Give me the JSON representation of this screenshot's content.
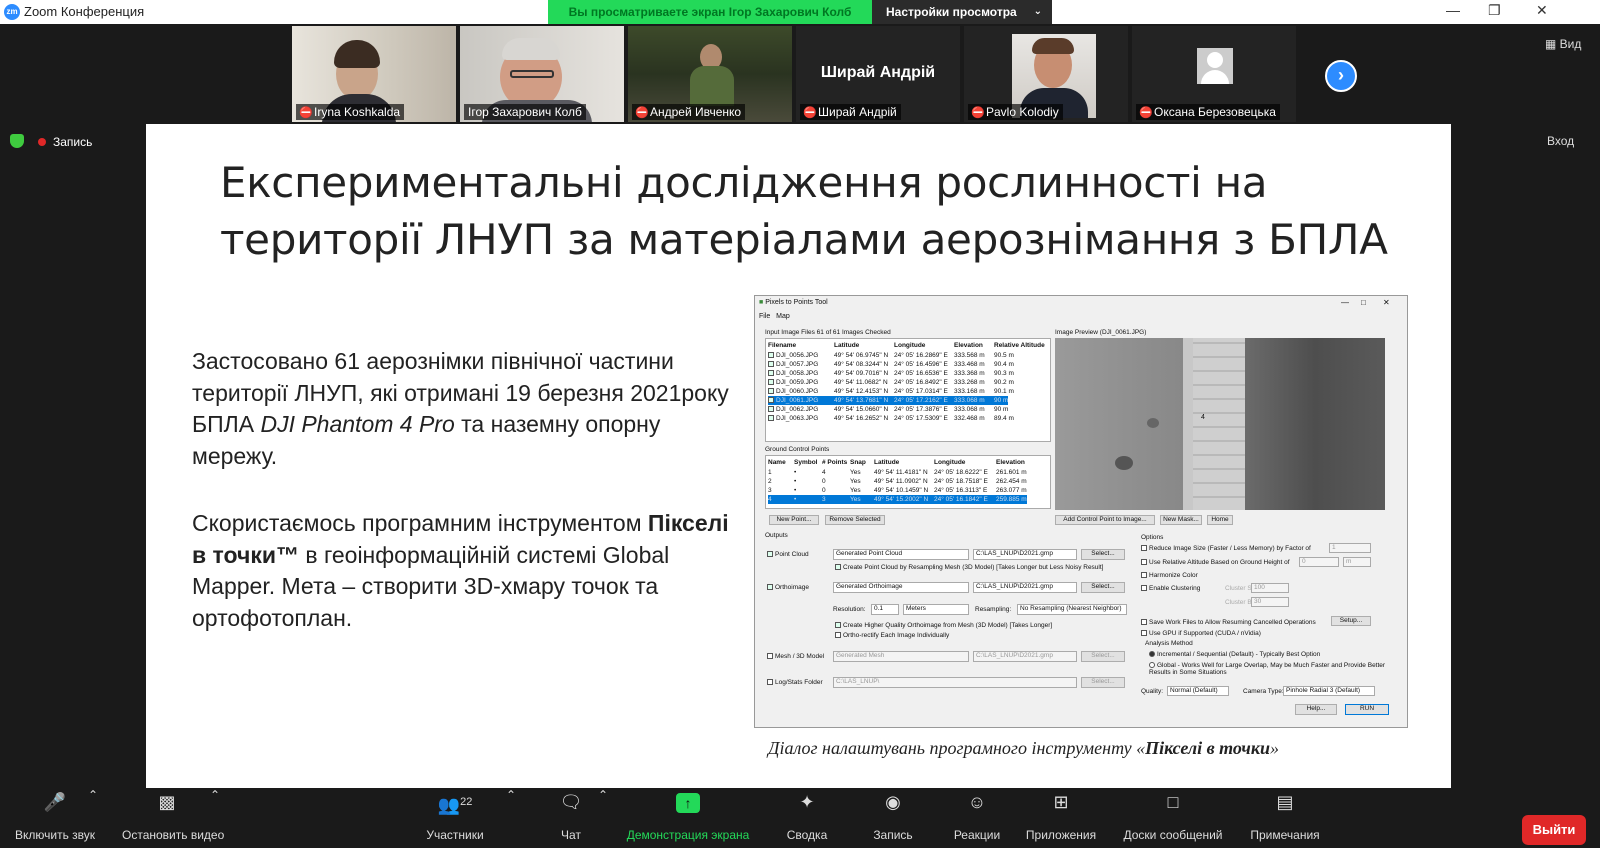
{
  "app": {
    "title": "Zoom Конференция",
    "logo": "zm"
  },
  "share_banner": {
    "text": "Вы просматриваете экран Ігор Захарович Колб",
    "settings": "Настройки просмотра"
  },
  "view_button": "Вид",
  "next_icon": "chevron-right-icon",
  "participants": [
    {
      "name": "Iryna Koshkalda",
      "video": true,
      "muted": true
    },
    {
      "name": "Ігор Захарович Колб",
      "video": true,
      "muted": false,
      "active": true
    },
    {
      "name": "Андрей Ивченко",
      "video": true,
      "muted": true
    },
    {
      "name": "Ширай Андрій",
      "video": false,
      "muted": true,
      "display": "Ширай Андрій"
    },
    {
      "name": "Pavlo Kolodiy",
      "video": true,
      "muted": true
    },
    {
      "name": "Оксана Березовецька",
      "video": false,
      "muted": true
    }
  ],
  "recording": {
    "label": "Запись"
  },
  "enter_button": "Вход",
  "slide": {
    "title": "Експериментальні дослідження рослинності на території  ЛНУП за матеріалами аерознімання з БПЛА",
    "para1": {
      "a": "Застосовано 61 аерознімки північної частини території ЛНУП, які отримані 19 березня 2021року БПЛА ",
      "em": "DJI Phantom 4 Pro",
      "b": " та наземну опорну мережу."
    },
    "para2": {
      "a": "Скористаємось програмним інструментом ",
      "strong": "Пікселі в точки™",
      "b": " в геоінформаційній системі Global Mapper.  Мета – створити 3D-хмару точок та ортофотоплан."
    },
    "caption": {
      "a": "Діалог налаштувань програмного інструменту «",
      "strong": "Пікселі в точки",
      "b": "»"
    }
  },
  "dialog": {
    "title": "Pixels to Points Tool",
    "menu": [
      "File",
      "Map"
    ],
    "input_header": "Input Image Files 61 of 61 Images Checked",
    "image_columns": [
      "Filename",
      "Latitude",
      "Longitude",
      "Elevation",
      "Relative Altitude"
    ],
    "images": [
      [
        "DJI_0056.JPG",
        "49° 54' 06.9745\" N",
        "24° 05' 16.2869\" E",
        "333.568 m",
        "90.5 m"
      ],
      [
        "DJI_0057.JPG",
        "49° 54' 08.3244\" N",
        "24° 05' 16.4596\" E",
        "333.468 m",
        "90.4 m"
      ],
      [
        "DJI_0058.JPG",
        "49° 54' 09.7016\" N",
        "24° 05' 16.6536\" E",
        "333.368 m",
        "90.3 m"
      ],
      [
        "DJI_0059.JPG",
        "49° 54' 11.0682\" N",
        "24° 05' 16.8492\" E",
        "333.268 m",
        "90.2 m"
      ],
      [
        "DJI_0060.JPG",
        "49° 54' 12.4153\" N",
        "24° 05' 17.0314\" E",
        "333.168 m",
        "90.1 m"
      ],
      [
        "DJI_0061.JPG",
        "49° 54' 13.7681\" N",
        "24° 05' 17.2162\" E",
        "333.068 m",
        "90 m"
      ],
      [
        "DJI_0062.JPG",
        "49° 54' 15.0660\" N",
        "24° 05' 17.3876\" E",
        "333.068 m",
        "90 m"
      ],
      [
        "DJI_0063.JPG",
        "49° 54' 16.2652\" N",
        "24° 05' 17.5309\" E",
        "332.468 m",
        "89.4 m"
      ]
    ],
    "preview_header": "Image Preview (DJI_0061.JPG)",
    "preview_marker": "4",
    "gcp_header": "Ground Control Points",
    "gcp_columns": [
      "Name",
      "Symbol",
      "# Points",
      "Snap",
      "Latitude",
      "Longitude",
      "Elevation"
    ],
    "gcps": [
      [
        "1",
        "•",
        "4",
        "Yes",
        "49° 54' 11.4181\" N",
        "24° 05' 18.6222\" E",
        "261.601 m"
      ],
      [
        "2",
        "•",
        "0",
        "Yes",
        "49° 54' 11.0902\" N",
        "24° 05' 18.7518\" E",
        "262.454 m"
      ],
      [
        "3",
        "•",
        "0",
        "Yes",
        "49° 54' 10.1459\" N",
        "24° 05' 16.3113\" E",
        "263.077 m"
      ],
      [
        "4",
        "•",
        "3",
        "Yes",
        "49° 54' 15.2002\" N",
        "24° 05' 16.1842\" E",
        "259.885 m"
      ]
    ],
    "btn_new_point": "New Point...",
    "btn_remove": "Remove Selected",
    "btn_add_cp": "Add Control Point to Image...",
    "btn_new_mask": "New Mask...",
    "btn_home": "Home",
    "outputs_label": "Outputs",
    "point_cloud": {
      "label": "Point Cloud",
      "name": "Generated Point Cloud",
      "path": "C:\\LAS_LNUP\\D2021.gmp",
      "select": "Select...",
      "resample": "Create Point Cloud by Resampling Mesh (3D Model) [Takes Longer but Less Noisy Result]"
    },
    "orthoimage": {
      "label": "Orthoimage",
      "name": "Generated Orthoimage",
      "path": "C:\\LAS_LNUP\\D2021.gmp",
      "select": "Select..."
    },
    "resolution_label": "Resolution:",
    "resolution": "0.1",
    "units": "Meters",
    "resampling_label": "Resampling:",
    "resampling": "No Resampling (Nearest Neighbor)",
    "hq_ortho": "Create Higher Quality Orthoimage from Mesh (3D Model) [Takes Longer]",
    "ortho_rectify": "Ortho-rectify Each Image Individually",
    "mesh": {
      "label": "Mesh / 3D Model",
      "name": "Generated Mesh",
      "path": "C:\\LAS_LNUP\\D2021.gmp",
      "select": "Select..."
    },
    "log": {
      "label": "Log/Stats Folder",
      "path": "C:\\LAS_LNUP\\",
      "select": "Select..."
    },
    "options_label": "Options",
    "opt_reduce": "Reduce Image Size (Faster / Less Memory) by Factor of",
    "opt_reduce_val": "1",
    "opt_relalt": "Use Relative Altitude Based on Ground Height of",
    "opt_relalt_val": "0",
    "opt_relalt_unit": "m",
    "opt_harmonize": "Harmonize Color",
    "opt_cluster": "Enable Clustering",
    "cluster_size_label": "Cluster Size",
    "cluster_size": "100",
    "cluster_bound_label": "Cluster Bound",
    "cluster_bound": "30",
    "opt_save": "Save Work Files to Allow Resuming Cancelled Operations",
    "btn_setup": "Setup...",
    "opt_gpu": "Use GPU if Supported (CUDA / nVidia)",
    "analysis_label": "Analysis Method",
    "method1": "Incremental / Sequential (Default) - Typically Best Option",
    "method2": "Global - Works Well for Large Overlap, May be Much Faster and Provide Better Results in Some Situations",
    "quality_label": "Quality:",
    "quality": "Normal (Default)",
    "camera_label": "Camera Type:",
    "camera": "Pinhole Radial 3 (Default)",
    "btn_help": "Help...",
    "btn_run": "RUN"
  },
  "toolbar": {
    "mute": "Включить звук",
    "video": "Остановить видео",
    "participants": "Участники",
    "participants_count": "22",
    "chat": "Чат",
    "share": "Демонстрация экрана",
    "summary": "Сводка",
    "record": "Запись",
    "reactions": "Реакции",
    "apps": "Приложения",
    "whiteboards": "Доски сообщений",
    "notes": "Примечания",
    "leave": "Выйти"
  },
  "colors": {
    "share_green": "#23d959",
    "zoom_blue": "#2d8cff",
    "leave_red": "#e02828",
    "selection_blue": "#0078d7"
  }
}
